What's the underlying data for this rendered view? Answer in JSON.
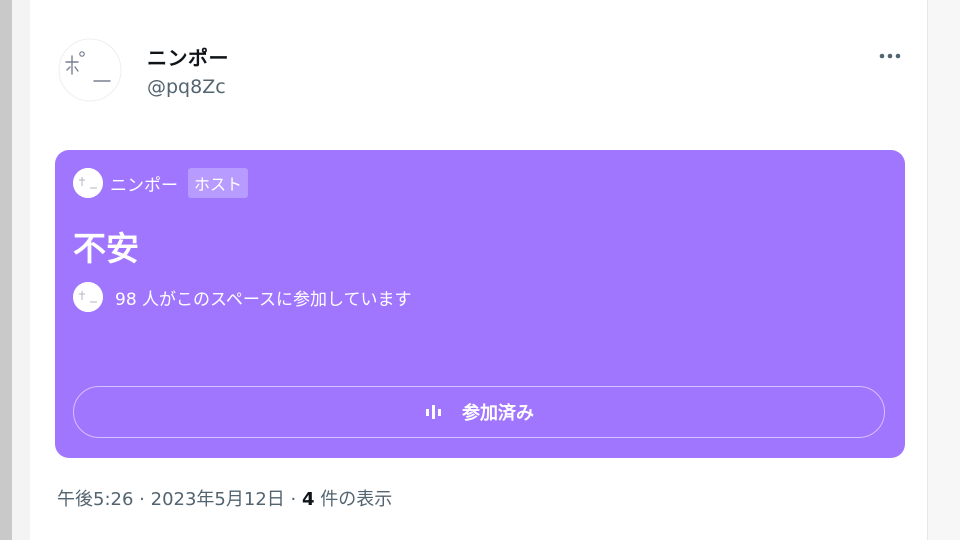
{
  "tweet": {
    "display_name": "ニンポー",
    "handle": "@pq8Zc",
    "avatar_text": "ポー",
    "more_label": "•••"
  },
  "space": {
    "host_name": "ニンポー",
    "host_badge": "ホスト",
    "title": "不安",
    "listener_text": "98 人がこのスペースに参加しています",
    "button_label": "参加済み",
    "card_color": "#a176ff"
  },
  "meta": {
    "time": "午後5:26",
    "separator": "·",
    "date": "2023年5月12日",
    "views_count": "4",
    "views_label": "件の表示"
  }
}
